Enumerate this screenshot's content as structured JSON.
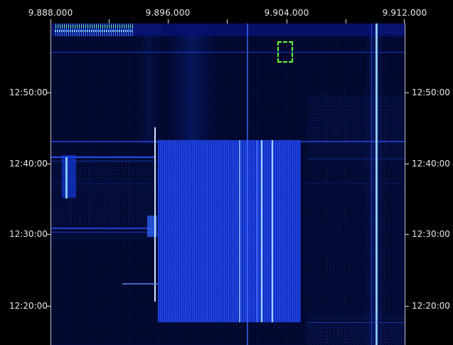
{
  "spectrogram": {
    "freq_axis": [
      "9.888.000",
      "9.896.000",
      "9.904.000",
      "9.912.000"
    ],
    "time_axis": [
      "12:50:00",
      "12:40:00",
      "12:30:00",
      "12:20:00"
    ],
    "colors": {
      "background": "#000000",
      "signal_low": "#0a1a8c",
      "signal_high": "#3a6cff",
      "peak": "#9fd0ff",
      "selection": "#66ff33"
    }
  }
}
